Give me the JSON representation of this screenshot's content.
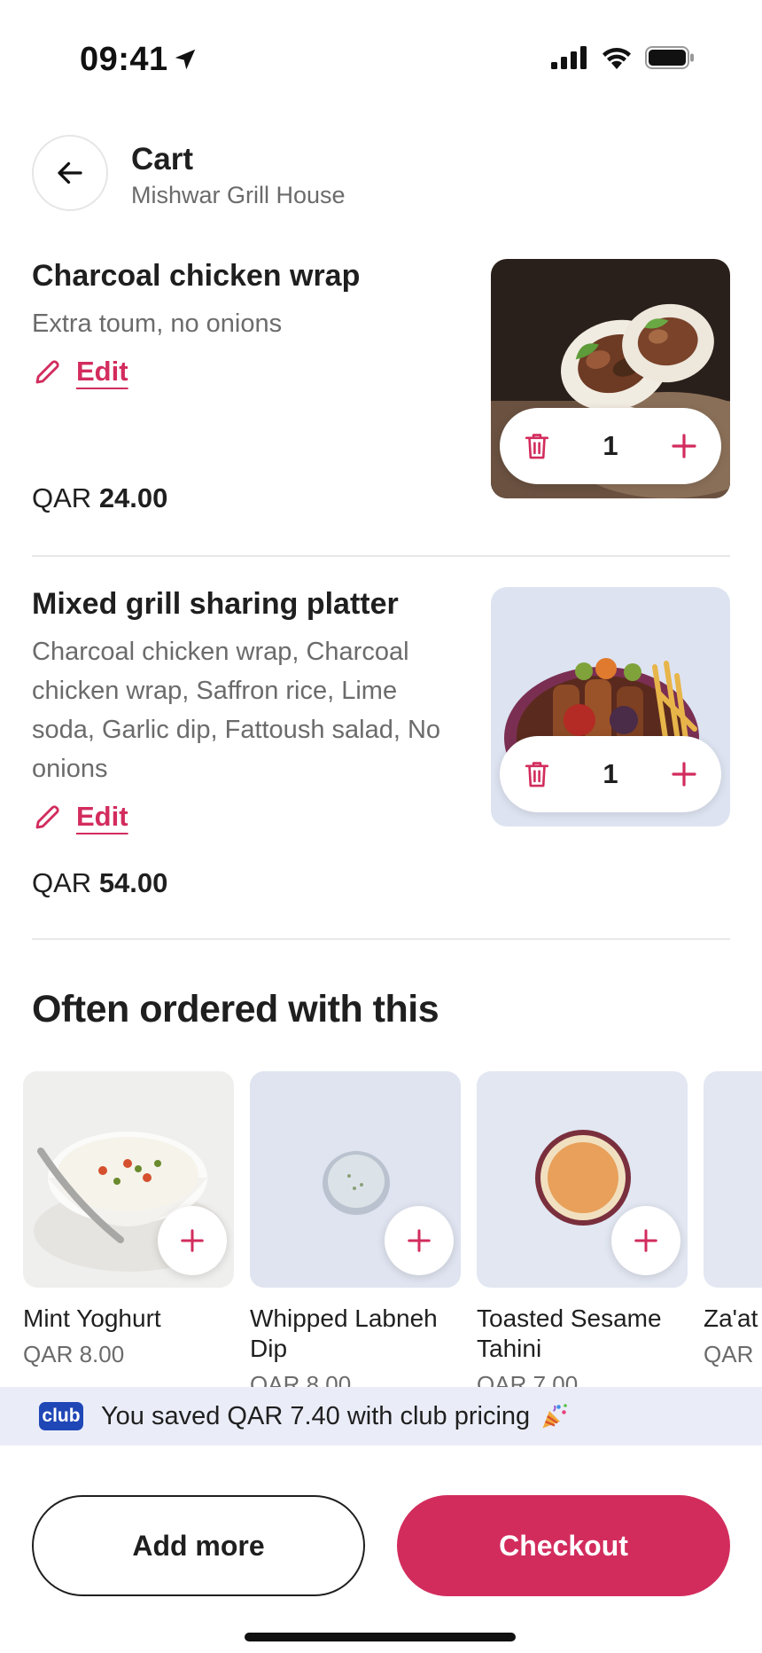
{
  "status_bar": {
    "time": "09:41"
  },
  "header": {
    "title": "Cart",
    "subtitle": "Mishwar Grill House"
  },
  "cart_items": [
    {
      "name": "Charcoal chicken wrap",
      "description": "Extra toum, no onions",
      "edit_label": "Edit",
      "currency": "QAR",
      "price": "24.00",
      "quantity": "1"
    },
    {
      "name": "Mixed grill sharing platter",
      "description": "Charcoal chicken wrap, Charcoal chicken wrap, Saffron rice, Lime soda, Garlic dip, Fattoush salad, No onions",
      "edit_label": "Edit",
      "currency": "QAR",
      "price": "54.00",
      "quantity": "1"
    }
  ],
  "recommendations": {
    "title": "Often ordered with this",
    "items": [
      {
        "name": "Mint Yoghurt",
        "price": "QAR 8.00"
      },
      {
        "name": "Whipped Labneh Dip",
        "price": "QAR 8.00"
      },
      {
        "name": "Toasted Sesame Tahini",
        "price": "QAR 7.00"
      },
      {
        "name": "Za'at",
        "price": "QAR"
      }
    ]
  },
  "club_banner": {
    "badge": "club",
    "text": "You saved QAR 7.40 with club pricing"
  },
  "actions": {
    "add_more": "Add more",
    "checkout": "Checkout"
  },
  "colors": {
    "accent": "#d22c5d",
    "club_blue": "#1f47b6",
    "banner_bg": "#eaedf8"
  }
}
